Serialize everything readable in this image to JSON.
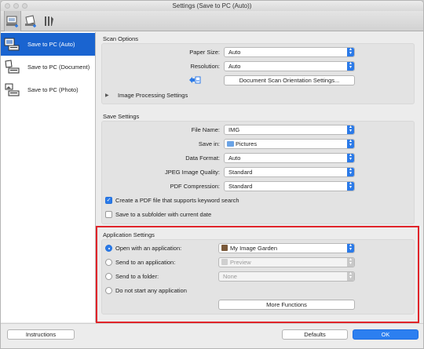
{
  "window": {
    "title": "Settings (Save to PC (Auto))"
  },
  "toolbar": {
    "tabs": [
      "scanner-save-icon",
      "document-icon",
      "tools-icon"
    ]
  },
  "sidebar": {
    "items": [
      {
        "label": "Save to PC (Auto)",
        "icon": "auto-scan-icon",
        "selected": true
      },
      {
        "label": "Save to PC (Document)",
        "icon": "document-scan-icon",
        "selected": false
      },
      {
        "label": "Save to PC (Photo)",
        "icon": "photo-scan-icon",
        "selected": false
      }
    ]
  },
  "scan_options": {
    "title": "Scan Options",
    "paper_size_label": "Paper Size:",
    "paper_size_value": "Auto",
    "resolution_label": "Resolution:",
    "resolution_value": "Auto",
    "orientation_button": "Document Scan Orientation Settings...",
    "image_processing_label": "Image Processing Settings"
  },
  "save_settings": {
    "title": "Save Settings",
    "file_name_label": "File Name:",
    "file_name_value": "IMG",
    "save_in_label": "Save in:",
    "save_in_value": "Pictures",
    "data_format_label": "Data Format:",
    "data_format_value": "Auto",
    "jpeg_quality_label": "JPEG Image Quality:",
    "jpeg_quality_value": "Standard",
    "pdf_compression_label": "PDF Compression:",
    "pdf_compression_value": "Standard",
    "keyword_pdf_label": "Create a PDF file that supports keyword search",
    "keyword_pdf_checked": true,
    "subfolder_label": "Save to a subfolder with current date",
    "subfolder_checked": false
  },
  "application_settings": {
    "title": "Application Settings",
    "open_app_label": "Open with an application:",
    "open_app_value": "My Image Garden",
    "send_app_label": "Send to an application:",
    "send_app_value": "Preview",
    "send_folder_label": "Send to a folder:",
    "send_folder_value": "None",
    "no_app_label": "Do not start any application",
    "more_functions": "More Functions",
    "selected": "open_app"
  },
  "footer": {
    "instructions": "Instructions",
    "defaults": "Defaults",
    "ok": "OK"
  },
  "colors": {
    "accent": "#2b7ae8",
    "selection": "#1a64d0",
    "highlight_box": "#e0242a"
  }
}
